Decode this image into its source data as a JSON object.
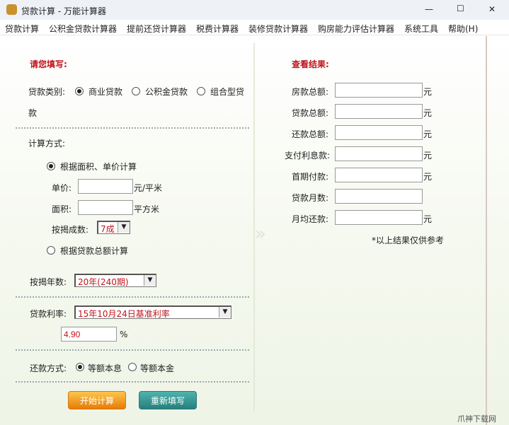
{
  "window": {
    "title": "贷款计算 - 万能计算器",
    "minimize": "—",
    "maximize": "☐",
    "close": "✕"
  },
  "menu": [
    "贷款计算",
    "公积金贷款计算器",
    "提前还贷计算器",
    "税费计算器",
    "装修贷款计算器",
    "购房能力评估计算器",
    "系统工具",
    "帮助(H)"
  ],
  "left": {
    "title": "请您填写:",
    "loan_type_label": "贷款类别:",
    "loan_types": [
      "商业贷款",
      "公积金贷款",
      "组合型贷"
    ],
    "loan_type_wrap": "款",
    "calc_method_label": "计算方式:",
    "method_area": "根据面积、单价计算",
    "unit_price_label": "单价:",
    "unit_price_unit": "元/平米",
    "unit_price_value": "",
    "area_label": "面积:",
    "area_unit": "平方米",
    "area_value": "",
    "ratio_label": "按揭成数:",
    "ratio_value": "7成",
    "method_total": "根据贷款总额计算",
    "years_label": "按揭年数:",
    "years_value": "20年(240期)",
    "rate_label": "贷款利率:",
    "rate_value": "15年10月24日基准利率",
    "rate_input": "4.90",
    "rate_unit": "%",
    "repay_label": "还款方式:",
    "repay_options": [
      "等额本息",
      "等额本金"
    ],
    "calc_button": "开始计算",
    "reset_button": "重新填写"
  },
  "right": {
    "title": "查看结果:",
    "rows": [
      {
        "label": "房款总额:",
        "unit": "元"
      },
      {
        "label": "贷款总额:",
        "unit": "元"
      },
      {
        "label": "还款总额:",
        "unit": "元"
      },
      {
        "label": "支付利息款:",
        "unit": "元"
      },
      {
        "label": "首期付款:",
        "unit": "元"
      },
      {
        "label": "贷款月数:",
        "unit": ""
      },
      {
        "label": "月均还款:",
        "unit": "元"
      }
    ],
    "note": "*以上结果仅供参考"
  },
  "watermark": "爪神下载网"
}
